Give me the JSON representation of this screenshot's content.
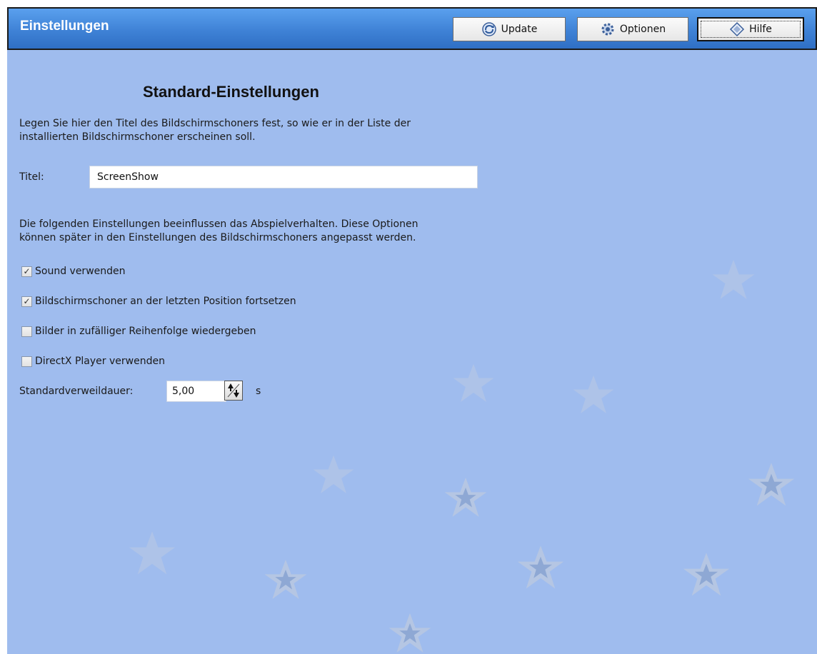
{
  "header": {
    "title": "Einstellungen",
    "buttons": [
      {
        "label": "Update",
        "icon": "update-icon"
      },
      {
        "label": "Optionen",
        "icon": "options-icon"
      },
      {
        "label": "Hilfe",
        "icon": "help-icon"
      }
    ],
    "accent_color": "#3f82d6"
  },
  "main": {
    "title": "Standard-Einstellungen",
    "intro_line1": "Legen Sie hier den Titel des Bildschirmschoners fest, so wie er in der Liste der",
    "intro_line2": "installierten Bildschirmschoner erscheinen soll.",
    "title_field": {
      "label": "Titel:",
      "value": "ScreenShow"
    },
    "playback_line1": "Die folgenden Einstellungen beeinflussen das Abspielverhalten. Diese Optionen",
    "playback_line2": "können später in den Einstellungen des Bildschirmschoners angepasst werden.",
    "options": [
      {
        "label": "Sound verwenden",
        "checked": true
      },
      {
        "label": "Bildschirmschoner an der letzten Position fortsetzen",
        "checked": true
      },
      {
        "label": "Bilder in zufälliger Reihenfolge wiedergeben",
        "checked": false
      },
      {
        "label": "DirectX Player verwenden",
        "checked": false
      }
    ],
    "dwell": {
      "label": "Standardverweildauer:",
      "value": "5,00",
      "unit": "s"
    }
  },
  "background_color": "#9fbcee"
}
